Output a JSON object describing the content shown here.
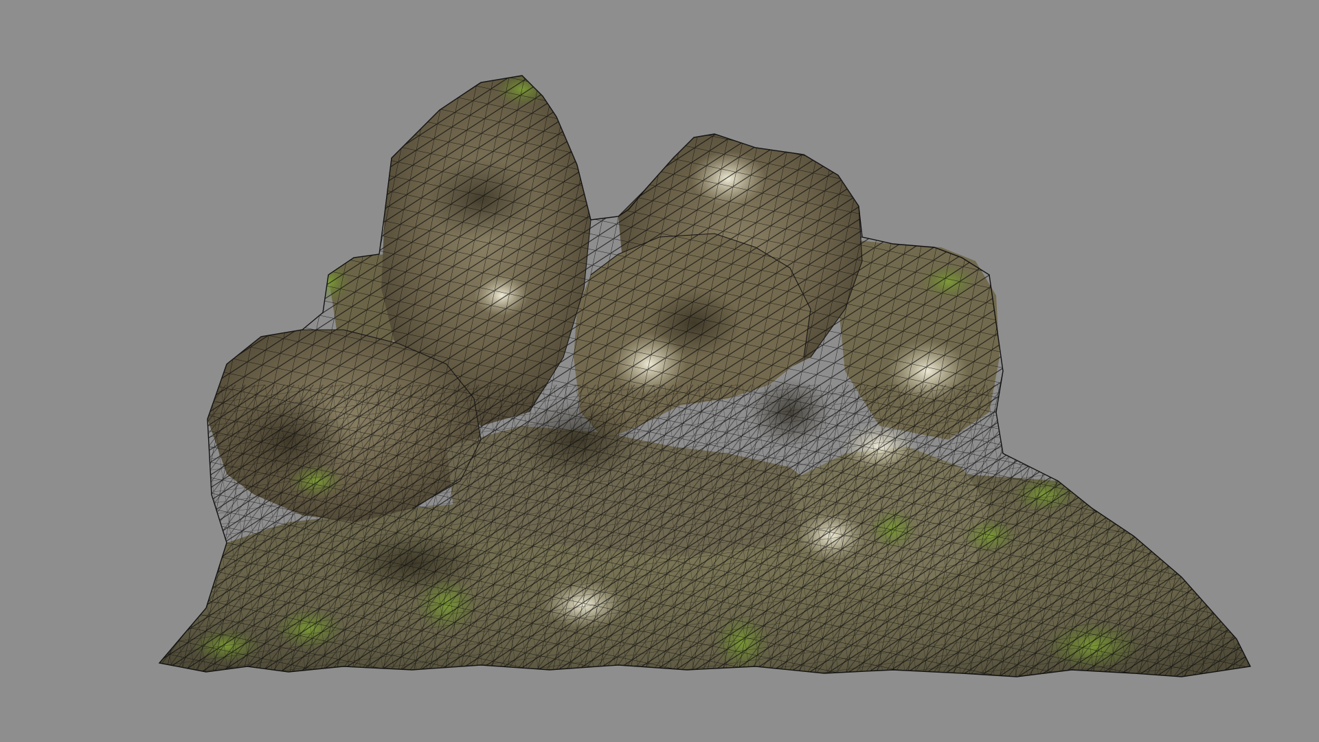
{
  "scene": {
    "background_color": "#8e8e8e",
    "model": {
      "subject": "rock-cluster",
      "display_mode": "textured-wireframe",
      "wire_color": "#0b0b0b",
      "moss_color": "#6f8c2c",
      "stone_color": "#6d6349"
    }
  }
}
